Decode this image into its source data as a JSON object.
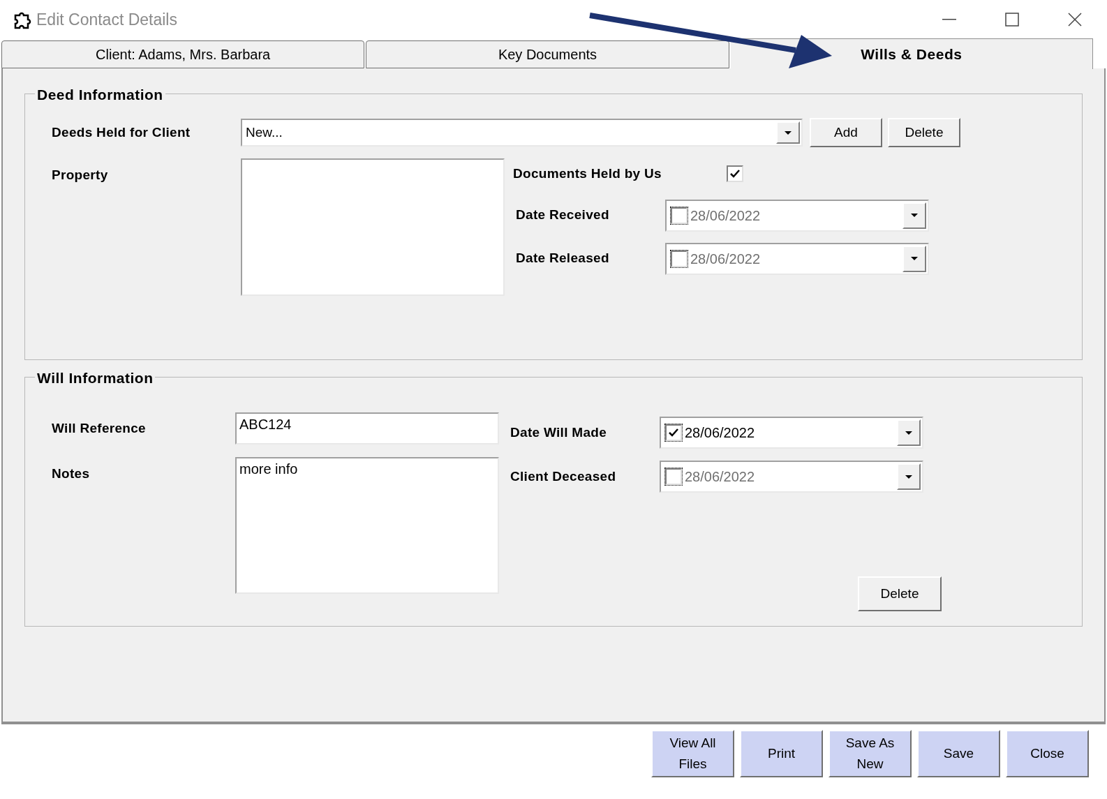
{
  "window": {
    "title": "Edit Contact Details"
  },
  "tabs": [
    {
      "label": "Client: Adams, Mrs. Barbara",
      "selected": false
    },
    {
      "label": "Key Documents",
      "selected": false
    },
    {
      "label": "Wills & Deeds",
      "selected": true
    }
  ],
  "deed_information": {
    "title": "Deed Information",
    "deeds_held_label": "Deeds Held for Client",
    "deeds_held_value": "New...",
    "add_button": "Add",
    "delete_button": "Delete",
    "property_label": "Property",
    "documents_held_label": "Documents Held by Us",
    "documents_held_checked": true,
    "dates": [
      {
        "label": "Date Received",
        "value": "28/06/2022",
        "checked": false
      },
      {
        "label": "Date Released",
        "value": "28/06/2022",
        "checked": false
      }
    ]
  },
  "will_information": {
    "title": "Will Information",
    "will_reference_label": "Will Reference",
    "will_reference_value": "ABC124",
    "notes_label": "Notes",
    "notes_value": "more info",
    "dates": [
      {
        "label": "Date Will Made",
        "value": "28/06/2022",
        "checked": true
      },
      {
        "label": "Client Deceased",
        "value": "28/06/2022",
        "checked": false
      }
    ],
    "delete_button": "Delete"
  },
  "buttons": [
    "View All Files",
    "Print",
    "Save As New",
    "Save",
    "Close"
  ]
}
